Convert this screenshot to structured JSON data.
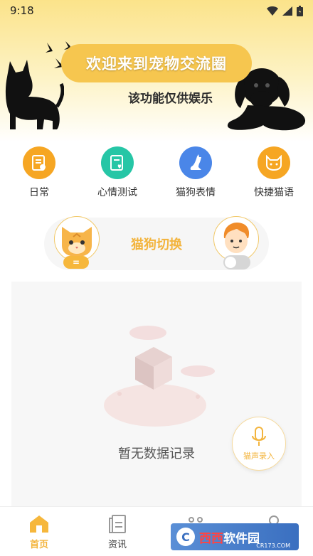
{
  "status_bar": {
    "time": "9:18"
  },
  "banner": {
    "title": "欢迎来到宠物交流圈",
    "subtitle": "该功能仅供娱乐"
  },
  "quick_actions": [
    {
      "label": "日常",
      "icon": "calendar-icon",
      "color": "#f6a623"
    },
    {
      "label": "心情测试",
      "icon": "heart-note-icon",
      "color": "#26c6a6"
    },
    {
      "label": "猫狗表情",
      "icon": "cat-icon",
      "color": "#4a86e8"
    },
    {
      "label": "快捷猫语",
      "icon": "cat-face-icon",
      "color": "#f6a623"
    }
  ],
  "switch_card": {
    "title": "猫狗切换",
    "left_avatar": "cat-avatar-icon",
    "right_avatar": "boy-avatar-icon",
    "left_toggle_glyph": "=",
    "right_toggle_on": false
  },
  "records": {
    "empty_text": "暂无数据记录",
    "record_button_label": "猫声录入"
  },
  "tabbar": {
    "tabs": [
      {
        "label": "首页",
        "icon": "home-icon",
        "active": true
      },
      {
        "label": "资讯",
        "icon": "document-icon",
        "active": false
      },
      {
        "label": "",
        "icon": "paw-icon",
        "active": false
      },
      {
        "label": "",
        "icon": "person-icon",
        "active": false
      }
    ]
  },
  "watermark": {
    "brand_red": "西西",
    "brand_white": "软件园",
    "url": "CR173.COM"
  },
  "colors": {
    "accent": "#f3b43d",
    "banner_top": "#fbe38a"
  }
}
